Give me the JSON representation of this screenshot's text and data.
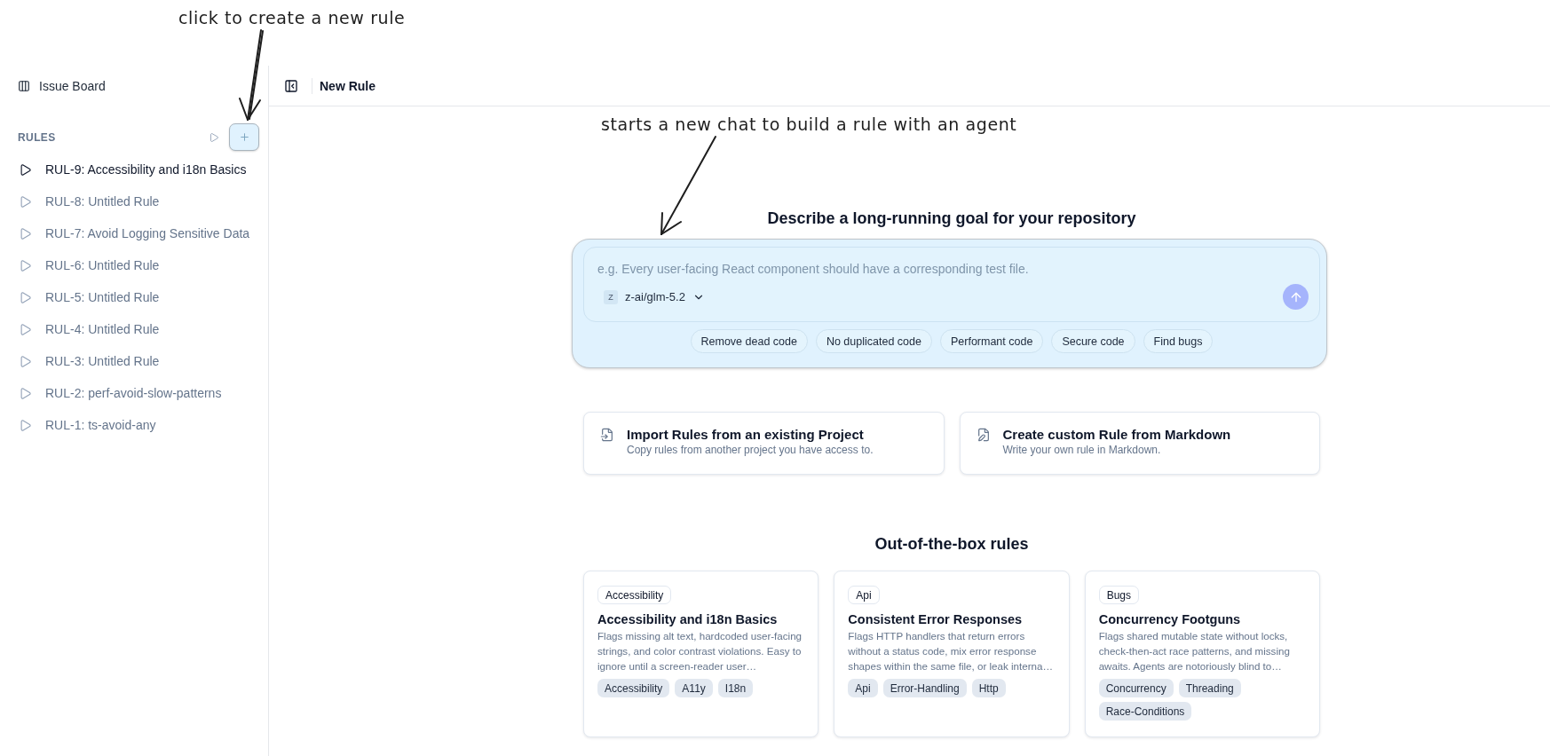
{
  "annotations": [
    {
      "text": "click to create a new rule"
    },
    {
      "text": "starts a new chat to build a rule with an agent"
    }
  ],
  "sidebar": {
    "top_link": "Issue Board",
    "section_label": "RULES",
    "rules": [
      {
        "label": "RUL-9: Accessibility and i18n Basics",
        "selected": true
      },
      {
        "label": "RUL-8: Untitled Rule",
        "selected": false
      },
      {
        "label": "RUL-7: Avoid Logging Sensitive Data",
        "selected": false
      },
      {
        "label": "RUL-6: Untitled Rule",
        "selected": false
      },
      {
        "label": "RUL-5: Untitled Rule",
        "selected": false
      },
      {
        "label": "RUL-4: Untitled Rule",
        "selected": false
      },
      {
        "label": "RUL-3: Untitled Rule",
        "selected": false
      },
      {
        "label": "RUL-2: perf-avoid-slow-patterns",
        "selected": false
      },
      {
        "label": "RUL-1: ts-avoid-any",
        "selected": false
      }
    ]
  },
  "header": {
    "title": "New Rule"
  },
  "composer": {
    "heading": "Describe a long-running goal for your repository",
    "placeholder": "e.g. Every user-facing React component should have a corresponding test file.",
    "model": {
      "badge": "Z",
      "name": "z-ai/glm-5.2"
    },
    "send_button": {
      "disabled": true
    },
    "suggestions": [
      "Remove dead code",
      "No duplicated code",
      "Performant code",
      "Secure code",
      "Find bugs"
    ]
  },
  "actions": [
    {
      "kind": "import",
      "title": "Import Rules from an existing Project",
      "description": "Copy rules from another project you have access to."
    },
    {
      "kind": "markdown",
      "title": "Create custom Rule from Markdown",
      "description": "Write your own rule in Markdown."
    }
  ],
  "templates": {
    "heading": "Out-of-the-box rules",
    "cards": [
      {
        "category": "Accessibility",
        "title": "Accessibility and i18n Basics",
        "description": "Flags missing alt text, hardcoded user-facing strings, and color contrast violations. Easy to ignore until a screen-reader user…",
        "tags": [
          "Accessibility",
          "A11y",
          "I18n"
        ]
      },
      {
        "category": "Api",
        "title": "Consistent Error Responses",
        "description": "Flags HTTP handlers that return errors without a status code, mix error response shapes within the same file, or leak interna…",
        "tags": [
          "Api",
          "Error-Handling",
          "Http"
        ]
      },
      {
        "category": "Bugs",
        "title": "Concurrency Footguns",
        "description": "Flags shared mutable state without locks, check-then-act race patterns, and missing awaits. Agents are notoriously blind to…",
        "tags": [
          "Concurrency",
          "Threading",
          "Race-Conditions"
        ]
      }
    ]
  }
}
